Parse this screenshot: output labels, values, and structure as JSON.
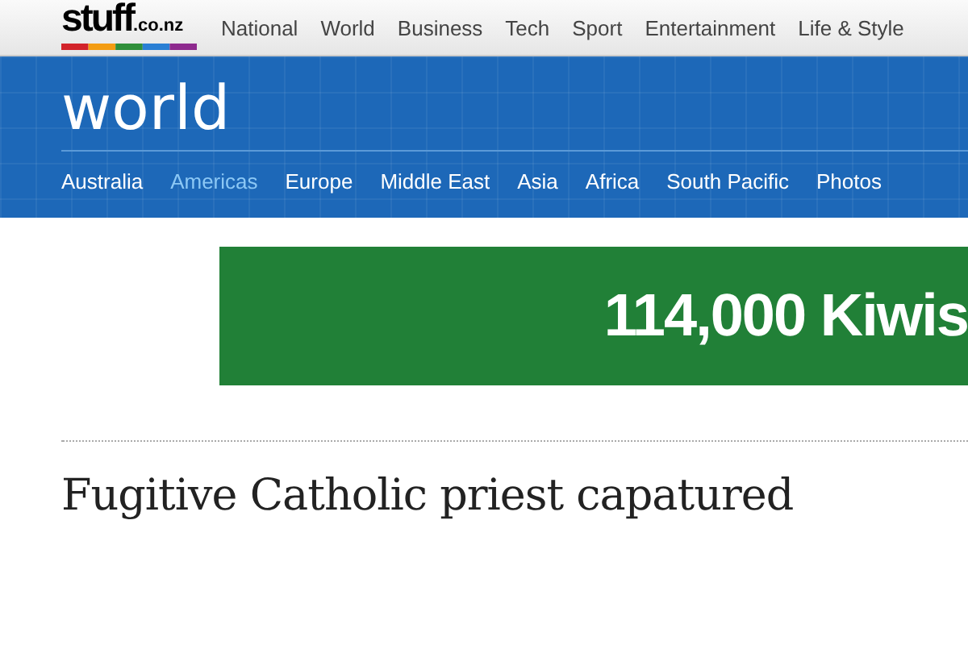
{
  "logo": {
    "name": "stuff",
    "domain": ".co.nz"
  },
  "top_nav": [
    {
      "label": "National"
    },
    {
      "label": "World"
    },
    {
      "label": "Business"
    },
    {
      "label": "Tech"
    },
    {
      "label": "Sport"
    },
    {
      "label": "Entertainment"
    },
    {
      "label": "Life & Style"
    }
  ],
  "section": {
    "title": "world"
  },
  "section_nav": [
    {
      "label": "Australia",
      "selected": false
    },
    {
      "label": "Americas",
      "selected": true
    },
    {
      "label": "Europe",
      "selected": false
    },
    {
      "label": "Middle East",
      "selected": false
    },
    {
      "label": "Asia",
      "selected": false
    },
    {
      "label": "Africa",
      "selected": false
    },
    {
      "label": "South Pacific",
      "selected": false
    },
    {
      "label": "Photos",
      "selected": false
    }
  ],
  "ad_banner": {
    "text": "114,000 Kiwis"
  },
  "article": {
    "headline": "Fugitive Catholic priest capatured"
  }
}
